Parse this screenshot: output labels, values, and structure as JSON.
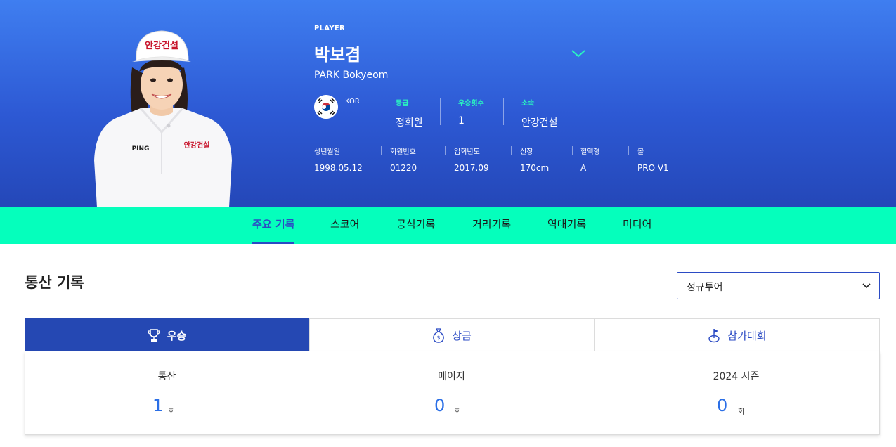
{
  "header": {
    "tag": "PLAYER",
    "name_kr": "박보겸",
    "name_en": "PARK Bokyeom",
    "cap_logo": "안강건설",
    "shirt_logo": "안강건설",
    "shirt_brand": "PING",
    "country": "KOR",
    "stats": [
      {
        "label": "등급",
        "value": "정회원"
      },
      {
        "label": "우승횟수",
        "value": "1"
      },
      {
        "label": "소속",
        "value": "안강건설"
      }
    ],
    "info": [
      {
        "label": "생년월일",
        "value": "1998.05.12"
      },
      {
        "label": "회원번호",
        "value": "01220"
      },
      {
        "label": "입회년도",
        "value": "2017.09"
      },
      {
        "label": "신장",
        "value": "170cm"
      },
      {
        "label": "혈액형",
        "value": "A"
      },
      {
        "label": "볼",
        "value": "PRO V1"
      }
    ]
  },
  "tabs": [
    {
      "label": "주요 기록",
      "active": true
    },
    {
      "label": "스코어",
      "active": false
    },
    {
      "label": "공식기록",
      "active": false
    },
    {
      "label": "거리기록",
      "active": false
    },
    {
      "label": "역대기록",
      "active": false
    },
    {
      "label": "미디어",
      "active": false
    }
  ],
  "section": {
    "title": "통산 기록",
    "select_value": "정규투어",
    "record_tabs": [
      {
        "label": "우승",
        "icon": "trophy-icon",
        "active": true
      },
      {
        "label": "상금",
        "icon": "money-bag-icon",
        "active": false
      },
      {
        "label": "참가대회",
        "icon": "golf-flag-icon",
        "active": false
      }
    ],
    "records": [
      {
        "label": "통산",
        "value": "1",
        "unit": "회"
      },
      {
        "label": "메이저",
        "value": "0",
        "unit": "회"
      },
      {
        "label": "2024 시즌",
        "value": "0",
        "unit": "회"
      }
    ]
  },
  "colors": {
    "hero_top": "#3f7ef0",
    "hero_bottom": "#2447b8",
    "tabbar": "#05ffbc",
    "accent": "#2b4bc4",
    "stat_label": "#2af5c0",
    "value_blue": "#2b6fe6"
  }
}
